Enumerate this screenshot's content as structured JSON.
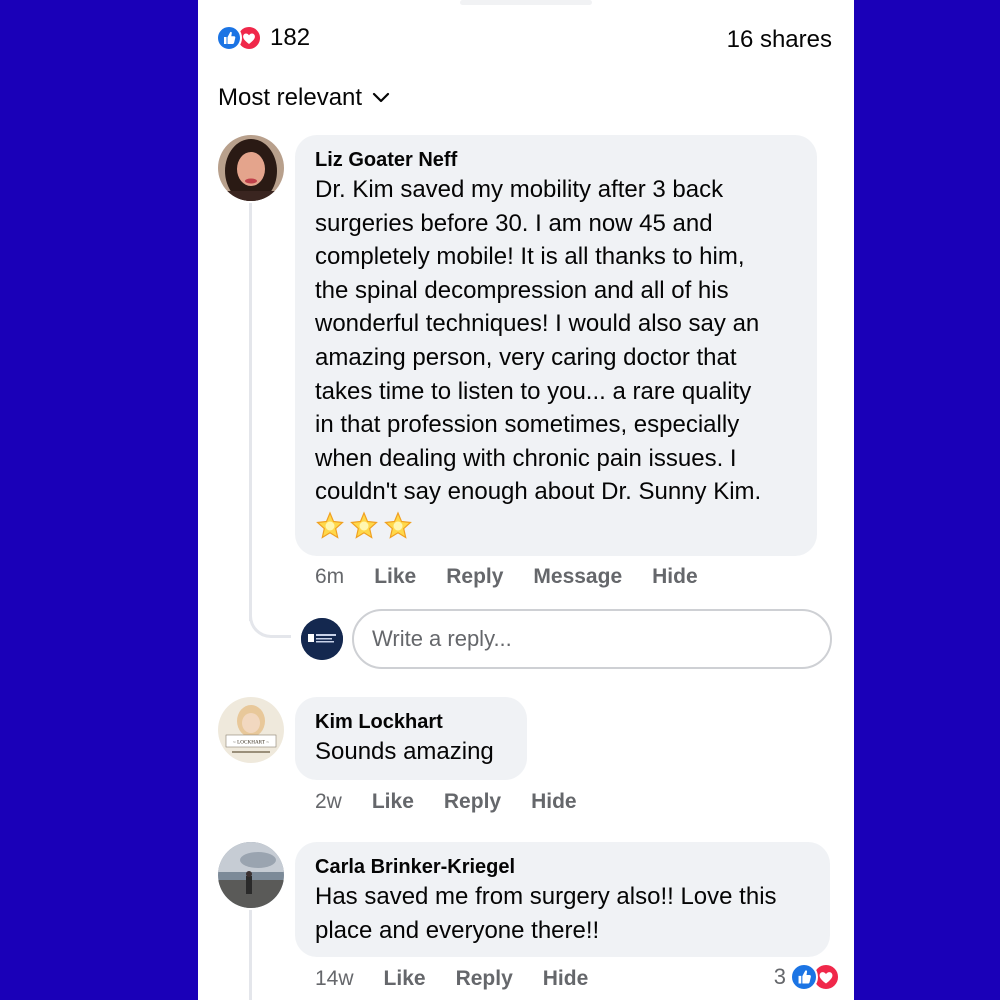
{
  "header": {
    "reaction_count": "182",
    "shares": "16 shares",
    "sort_label": "Most relevant"
  },
  "comments": [
    {
      "author": "Liz Goater Neff",
      "lines": [
        "Dr. Kim saved my mobility after 3 back",
        "surgeries before 30. I am now 45 and",
        "completely mobile! It is all thanks to him,",
        "the spinal decompression and all of his",
        "wonderful techniques! I would also say an",
        "amazing person, very caring doctor that",
        "takes time to listen to you... a rare quality",
        "in that profession sometimes, especially",
        "when dealing with chronic pain issues. I",
        "couldn't say enough about Dr. Sunny Kim."
      ],
      "emoji": "🌟🌟🌟",
      "time": "6m",
      "actions": [
        "Like",
        "Reply",
        "Message",
        "Hide"
      ]
    },
    {
      "author": "Kim Lockhart",
      "text": "Sounds amazing",
      "time": "2w",
      "actions": [
        "Like",
        "Reply",
        "Hide"
      ]
    },
    {
      "author": "Carla Brinker-Kriegel",
      "lines": [
        "Has saved me from surgery also!! Love this",
        "place and everyone there!!"
      ],
      "time": "14w",
      "actions": [
        "Like",
        "Reply",
        "Hide"
      ],
      "reaction_count": "3"
    }
  ],
  "reply_box": {
    "placeholder": "Write a reply..."
  },
  "avatar_text": {
    "lockhart_sign": "~ LOCKHART ~"
  },
  "colors": {
    "background": "#1a00b8",
    "like_blue": "#1b74e4",
    "love_red": "#f0284a",
    "bubble": "#f0f2f5",
    "meta_gray": "#65676b"
  },
  "icons": [
    "like-icon",
    "love-icon",
    "chevron-down-icon",
    "star-emoji"
  ]
}
